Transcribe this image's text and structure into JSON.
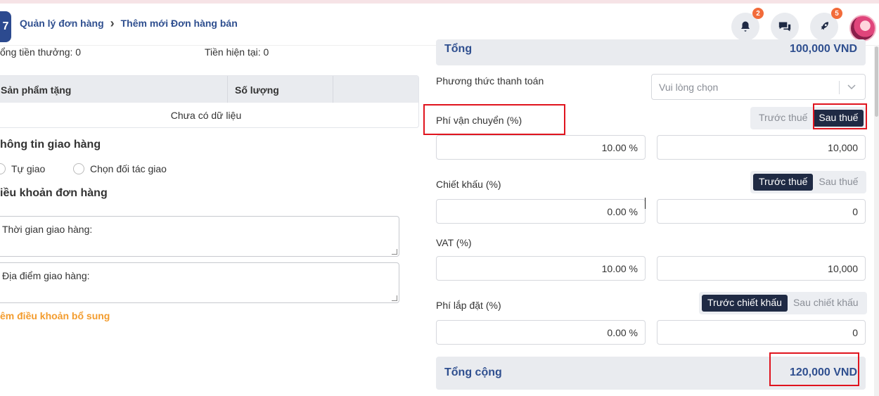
{
  "header": {
    "logo_text": "7",
    "breadcrumb": [
      "Quản lý đơn hàng",
      "Thêm mới Đơn hàng bán"
    ],
    "notifications_count": "2",
    "rocket_count": "5",
    "icons": [
      "bell-icon",
      "chat-icon",
      "rocket-icon"
    ]
  },
  "left": {
    "bonus_total": "ổng tiền thưởng: 0",
    "current_money": "Tiền hiện tại: 0",
    "gift_table": {
      "headers": [
        "Sản phẩm tặng",
        "Số lượng",
        ""
      ],
      "empty_text": "Chưa có dữ liệu"
    },
    "shipping_title": "hông tin giao hàng",
    "shipping_options": [
      "Tự giao",
      "Chọn đối tác giao"
    ],
    "terms_title": "iều khoản đơn hàng",
    "delivery_time_label": "Thời gian giao hàng:",
    "delivery_place_label": "Địa điểm giao hàng:",
    "add_terms_link": "êm điều khoản bổ sung"
  },
  "right": {
    "top_total_label": "Tổng",
    "top_total_value": "100,000 VND",
    "payment_method_label": "Phương thức thanh toán",
    "payment_method_placeholder": "Vui lòng chọn",
    "shipping_fee": {
      "label": "Phí vận chuyển (%)",
      "options": [
        "Trước thuế",
        "Sau thuế"
      ],
      "selected": "Sau thuế",
      "percent": "10.00 %",
      "amount": "10,000"
    },
    "discount": {
      "label": "Chiết khấu (%)",
      "options": [
        "Trước thuế",
        "Sau thuế"
      ],
      "selected": "Trước thuế",
      "percent": "0.00 %",
      "amount": "0"
    },
    "vat": {
      "label": "VAT (%)",
      "percent": "10.00 %",
      "amount": "10,000"
    },
    "install_fee": {
      "label": "Phí lắp đặt (%)",
      "options": [
        "Trước chiết khấu",
        "Sau chiết khấu"
      ],
      "selected": "Trước chiết khấu",
      "percent": "0.00 %",
      "amount": "0"
    },
    "grand_total_label": "Tổng cộng",
    "grand_total_value": "120,000 VND"
  },
  "colors": {
    "primary": "#2f4f8f",
    "highlight_red": "#e0141e",
    "orange_link": "#f39c2e",
    "toggle_active": "#1f2a44"
  }
}
